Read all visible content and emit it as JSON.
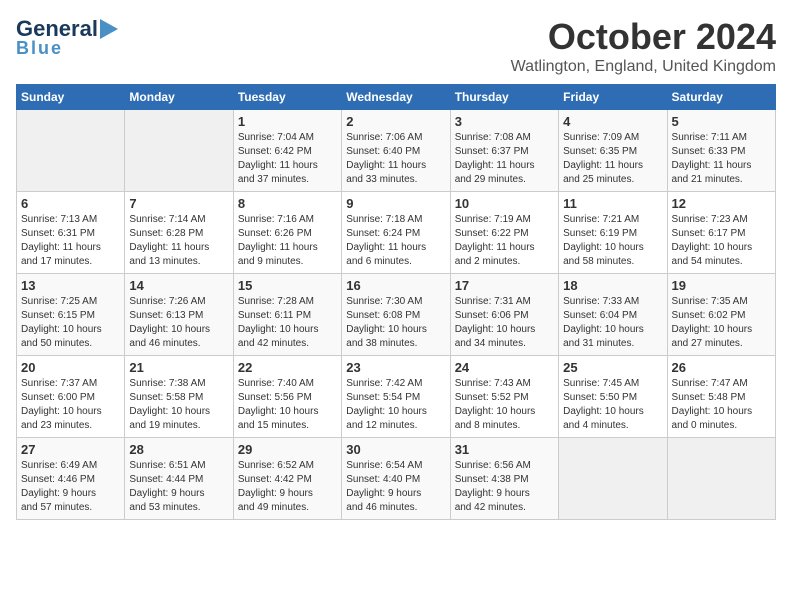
{
  "logo": {
    "line1a": "General",
    "line1b": "Blue",
    "triangle": "▶"
  },
  "title": "October 2024",
  "location": "Watlington, England, United Kingdom",
  "weekdays": [
    "Sunday",
    "Monday",
    "Tuesday",
    "Wednesday",
    "Thursday",
    "Friday",
    "Saturday"
  ],
  "weeks": [
    [
      {
        "day": "",
        "content": ""
      },
      {
        "day": "",
        "content": ""
      },
      {
        "day": "1",
        "content": "Sunrise: 7:04 AM\nSunset: 6:42 PM\nDaylight: 11 hours\nand 37 minutes."
      },
      {
        "day": "2",
        "content": "Sunrise: 7:06 AM\nSunset: 6:40 PM\nDaylight: 11 hours\nand 33 minutes."
      },
      {
        "day": "3",
        "content": "Sunrise: 7:08 AM\nSunset: 6:37 PM\nDaylight: 11 hours\nand 29 minutes."
      },
      {
        "day": "4",
        "content": "Sunrise: 7:09 AM\nSunset: 6:35 PM\nDaylight: 11 hours\nand 25 minutes."
      },
      {
        "day": "5",
        "content": "Sunrise: 7:11 AM\nSunset: 6:33 PM\nDaylight: 11 hours\nand 21 minutes."
      }
    ],
    [
      {
        "day": "6",
        "content": "Sunrise: 7:13 AM\nSunset: 6:31 PM\nDaylight: 11 hours\nand 17 minutes."
      },
      {
        "day": "7",
        "content": "Sunrise: 7:14 AM\nSunset: 6:28 PM\nDaylight: 11 hours\nand 13 minutes."
      },
      {
        "day": "8",
        "content": "Sunrise: 7:16 AM\nSunset: 6:26 PM\nDaylight: 11 hours\nand 9 minutes."
      },
      {
        "day": "9",
        "content": "Sunrise: 7:18 AM\nSunset: 6:24 PM\nDaylight: 11 hours\nand 6 minutes."
      },
      {
        "day": "10",
        "content": "Sunrise: 7:19 AM\nSunset: 6:22 PM\nDaylight: 11 hours\nand 2 minutes."
      },
      {
        "day": "11",
        "content": "Sunrise: 7:21 AM\nSunset: 6:19 PM\nDaylight: 10 hours\nand 58 minutes."
      },
      {
        "day": "12",
        "content": "Sunrise: 7:23 AM\nSunset: 6:17 PM\nDaylight: 10 hours\nand 54 minutes."
      }
    ],
    [
      {
        "day": "13",
        "content": "Sunrise: 7:25 AM\nSunset: 6:15 PM\nDaylight: 10 hours\nand 50 minutes."
      },
      {
        "day": "14",
        "content": "Sunrise: 7:26 AM\nSunset: 6:13 PM\nDaylight: 10 hours\nand 46 minutes."
      },
      {
        "day": "15",
        "content": "Sunrise: 7:28 AM\nSunset: 6:11 PM\nDaylight: 10 hours\nand 42 minutes."
      },
      {
        "day": "16",
        "content": "Sunrise: 7:30 AM\nSunset: 6:08 PM\nDaylight: 10 hours\nand 38 minutes."
      },
      {
        "day": "17",
        "content": "Sunrise: 7:31 AM\nSunset: 6:06 PM\nDaylight: 10 hours\nand 34 minutes."
      },
      {
        "day": "18",
        "content": "Sunrise: 7:33 AM\nSunset: 6:04 PM\nDaylight: 10 hours\nand 31 minutes."
      },
      {
        "day": "19",
        "content": "Sunrise: 7:35 AM\nSunset: 6:02 PM\nDaylight: 10 hours\nand 27 minutes."
      }
    ],
    [
      {
        "day": "20",
        "content": "Sunrise: 7:37 AM\nSunset: 6:00 PM\nDaylight: 10 hours\nand 23 minutes."
      },
      {
        "day": "21",
        "content": "Sunrise: 7:38 AM\nSunset: 5:58 PM\nDaylight: 10 hours\nand 19 minutes."
      },
      {
        "day": "22",
        "content": "Sunrise: 7:40 AM\nSunset: 5:56 PM\nDaylight: 10 hours\nand 15 minutes."
      },
      {
        "day": "23",
        "content": "Sunrise: 7:42 AM\nSunset: 5:54 PM\nDaylight: 10 hours\nand 12 minutes."
      },
      {
        "day": "24",
        "content": "Sunrise: 7:43 AM\nSunset: 5:52 PM\nDaylight: 10 hours\nand 8 minutes."
      },
      {
        "day": "25",
        "content": "Sunrise: 7:45 AM\nSunset: 5:50 PM\nDaylight: 10 hours\nand 4 minutes."
      },
      {
        "day": "26",
        "content": "Sunrise: 7:47 AM\nSunset: 5:48 PM\nDaylight: 10 hours\nand 0 minutes."
      }
    ],
    [
      {
        "day": "27",
        "content": "Sunrise: 6:49 AM\nSunset: 4:46 PM\nDaylight: 9 hours\nand 57 minutes."
      },
      {
        "day": "28",
        "content": "Sunrise: 6:51 AM\nSunset: 4:44 PM\nDaylight: 9 hours\nand 53 minutes."
      },
      {
        "day": "29",
        "content": "Sunrise: 6:52 AM\nSunset: 4:42 PM\nDaylight: 9 hours\nand 49 minutes."
      },
      {
        "day": "30",
        "content": "Sunrise: 6:54 AM\nSunset: 4:40 PM\nDaylight: 9 hours\nand 46 minutes."
      },
      {
        "day": "31",
        "content": "Sunrise: 6:56 AM\nSunset: 4:38 PM\nDaylight: 9 hours\nand 42 minutes."
      },
      {
        "day": "",
        "content": ""
      },
      {
        "day": "",
        "content": ""
      }
    ]
  ]
}
